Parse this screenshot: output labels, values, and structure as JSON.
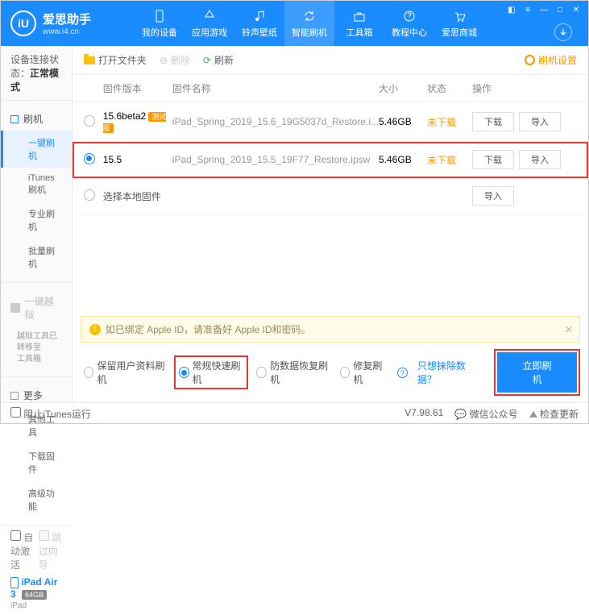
{
  "brand": {
    "name": "爱思助手",
    "url": "www.i4.cn",
    "logo": "iU"
  },
  "nav": [
    {
      "label": "我的设备",
      "icon": "phone"
    },
    {
      "label": "应用游戏",
      "icon": "app"
    },
    {
      "label": "铃声壁纸",
      "icon": "music"
    },
    {
      "label": "智能刷机",
      "icon": "refresh",
      "active": true
    },
    {
      "label": "工具箱",
      "icon": "toolbox"
    },
    {
      "label": "教程中心",
      "icon": "help"
    },
    {
      "label": "爱思商城",
      "icon": "cart"
    }
  ],
  "conn": {
    "label": "设备连接状态：",
    "value": "正常模式"
  },
  "side": {
    "flash": {
      "title": "刷机",
      "items": [
        "一键刷机",
        "iTunes刷机",
        "专业刷机",
        "批量刷机"
      ],
      "active": 0
    },
    "jail": {
      "title": "一键越狱",
      "note": "越狱工具已转移至\n工具箱"
    },
    "more": {
      "title": "更多",
      "items": [
        "其他工具",
        "下载固件",
        "高级功能"
      ]
    }
  },
  "device": {
    "auto": "自动激活",
    "skip": "跳过向导",
    "name": "iPad Air 3",
    "storage": "64GB",
    "sub": "iPad"
  },
  "toolbar": {
    "open": "打开文件夹",
    "del": "删除",
    "refresh": "刷新",
    "settings": "刷机设置"
  },
  "table": {
    "headers": {
      "ver": "固件版本",
      "name": "固件名称",
      "size": "大小",
      "status": "状态",
      "ops": "操作"
    },
    "rows": [
      {
        "ver": "15.6beta2",
        "beta": "测试版",
        "name": "iPad_Spring_2019_15.6_19G5037d_Restore.i...",
        "size": "5.46GB",
        "status": "未下载",
        "selected": false
      },
      {
        "ver": "15.5",
        "name": "iPad_Spring_2019_15.5_19F77_Restore.ipsw",
        "size": "5.46GB",
        "status": "未下载",
        "selected": true,
        "highlight": true
      }
    ],
    "local": "选择本地固件",
    "btn_dl": "下载",
    "btn_imp": "导入"
  },
  "alert": "如已绑定 Apple ID，请准备好 Apple ID和密码。",
  "modes": {
    "opts": [
      "保留用户资料刷机",
      "常规快速刷机",
      "防数据恢复刷机",
      "修复刷机"
    ],
    "selected": 1,
    "link": "只想抹除数据？",
    "flash": "立即刷机"
  },
  "status": {
    "block": "阻止iTunes运行",
    "ver": "V7.98.61",
    "wechat": "微信公众号",
    "check": "检查更新"
  }
}
